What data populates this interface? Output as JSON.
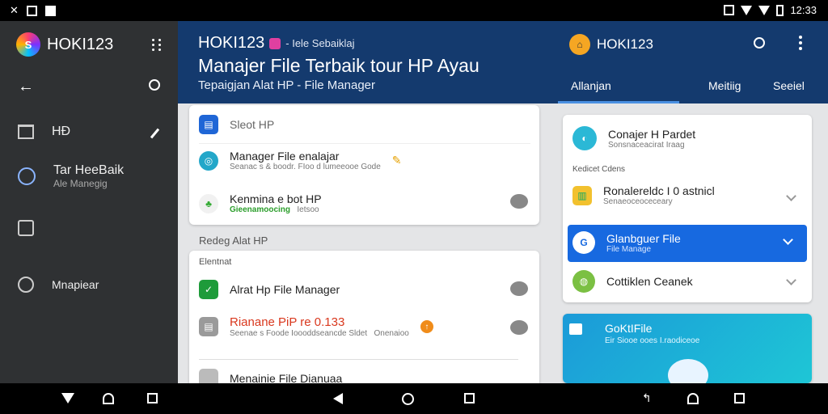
{
  "status": {
    "time": "12:33"
  },
  "drawer": {
    "app_name": "HOKI123",
    "items": [
      {
        "label": "HĐ"
      },
      {
        "label": "Tar HeeBaik",
        "sub": "Ale Manegig"
      },
      {
        "label": ""
      },
      {
        "label": "Mnapiear"
      }
    ]
  },
  "header": {
    "title": "HOKI123",
    "title_sub": "- Iele Sebaiklaj",
    "headline": "Manajer File Terbaik tour HP Ayau",
    "breadcrumb": "Tepaigjan   Alat HP  - File Manager"
  },
  "right_header": {
    "brand": "HOKI123",
    "tabs": [
      "Allanjan",
      "Meitiig",
      "Seeiel"
    ]
  },
  "card1": {
    "items": [
      {
        "title": "Sleot HP"
      },
      {
        "title": "Manager File enalajar",
        "sub": "Seanac s & boodr. FIoo d lumeeooe Gode"
      },
      {
        "title": "Kenmina e bot HP",
        "sub": "Gieenamoocing",
        "sub2": "Ietsoo"
      }
    ]
  },
  "section1": "Redeg Alat HP",
  "card2": {
    "section": "Elentnat",
    "items": [
      {
        "title": "Alrat Hp File Manager"
      },
      {
        "title": "Rianane PiP re 0.133",
        "sub": "Seenae s Foode Ioooddseancde Sldet",
        "sub2": "Onenaioo"
      },
      {
        "title": "Menainie File Dianuaa"
      }
    ]
  },
  "panel": {
    "top": {
      "title": "Conajer H Pardet",
      "sub": "Sonsnaceacirat Iraag"
    },
    "section": "Kedicet Cdens",
    "items": [
      {
        "title": "Ronalereldc I 0 astnicl",
        "sub": "Senaeoceoceceary"
      },
      {
        "title": "Glanbguer File",
        "sub": "File Manage"
      },
      {
        "title": "Cottiklen Ceanek"
      }
    ]
  },
  "promo": {
    "title": "GoKtIFile",
    "sub": "Eir Siooe ooes I.raodiceoe"
  },
  "colors": {
    "header_blue": "#143a6e",
    "selected": "#1769e0",
    "drawer": "#2f3133"
  }
}
